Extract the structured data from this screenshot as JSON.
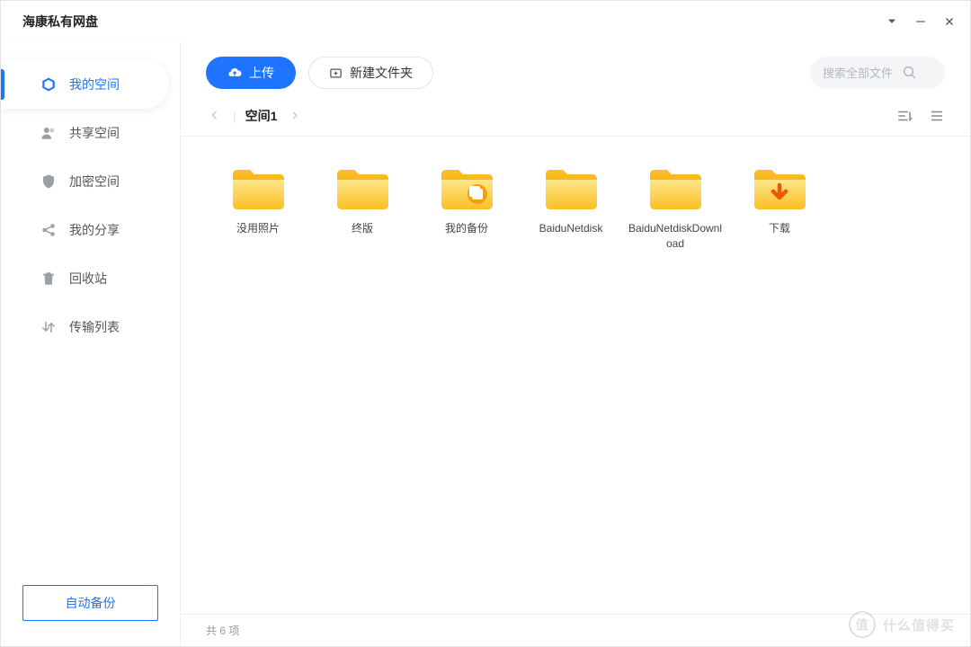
{
  "window": {
    "title": "海康私有网盘"
  },
  "sidebar": {
    "items": [
      {
        "label": "我的空间",
        "icon": "home"
      },
      {
        "label": "共享空间",
        "icon": "people"
      },
      {
        "label": "加密空间",
        "icon": "shield"
      },
      {
        "label": "我的分享",
        "icon": "share"
      },
      {
        "label": "回收站",
        "icon": "trash"
      },
      {
        "label": "传输列表",
        "icon": "transfer"
      }
    ],
    "backup_label": "自动备份"
  },
  "toolbar": {
    "upload_label": "上传",
    "new_folder_label": "新建文件夹",
    "search_placeholder": "搜索全部文件"
  },
  "breadcrumb": {
    "current": "空间1"
  },
  "folders": [
    {
      "name": "没用照片",
      "type": "plain"
    },
    {
      "name": "终版",
      "type": "plain"
    },
    {
      "name": "我的备份",
      "type": "backup"
    },
    {
      "name": "BaiduNetdisk",
      "type": "plain"
    },
    {
      "name": "BaiduNetdiskDownload",
      "type": "plain"
    },
    {
      "name": "下载",
      "type": "download"
    }
  ],
  "status": {
    "count_text": "共 6 项"
  },
  "watermark": {
    "text": "什么值得买",
    "badge": "值"
  }
}
